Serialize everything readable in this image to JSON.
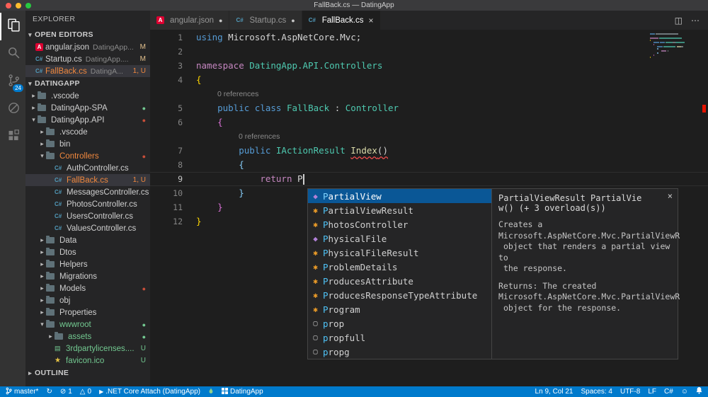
{
  "colors": {
    "accent": "#007acc",
    "error": "#f0883e",
    "untracked": "#73c991",
    "modified": "#e2c08d",
    "suggest_selected": "#0a5796",
    "status_bar": "#007acc",
    "error_marker": "#e51400"
  },
  "title_bar": {
    "title": "FallBack.cs — DatingApp"
  },
  "activity_bar": {
    "items": [
      {
        "name": "explorer",
        "active": true
      },
      {
        "name": "search"
      },
      {
        "name": "source-control",
        "badge": "24"
      },
      {
        "name": "debug"
      },
      {
        "name": "extensions"
      }
    ]
  },
  "sidebar": {
    "title": "EXPLORER",
    "sections": {
      "open_editors": {
        "label": "OPEN EDITORS",
        "items": [
          {
            "icon": "angular",
            "name": "angular.json",
            "detail": "DatingApp...",
            "badge": "M",
            "state": "modified"
          },
          {
            "icon": "csharp",
            "name": "Startup.cs",
            "detail": "DatingApp....",
            "badge": "M",
            "state": "modified"
          },
          {
            "icon": "csharp",
            "name": "FallBack.cs",
            "detail": "DatingA...",
            "badge": "1, U",
            "state": "error",
            "selected": true
          }
        ]
      },
      "project": {
        "label": "DATINGAPP",
        "tree": [
          {
            "name": ".vscode",
            "kind": "folder",
            "depth": 0,
            "arrow": "collapsed"
          },
          {
            "name": "DatingApp-SPA",
            "kind": "folder",
            "depth": 0,
            "arrow": "collapsed",
            "dot": "untracked"
          },
          {
            "name": "DatingApp.API",
            "kind": "folder",
            "depth": 0,
            "arrow": "expanded",
            "dot": "error"
          },
          {
            "name": ".vscode",
            "kind": "folder",
            "depth": 1,
            "arrow": "collapsed"
          },
          {
            "name": "bin",
            "kind": "folder",
            "depth": 1,
            "arrow": "collapsed"
          },
          {
            "name": "Controllers",
            "kind": "folder",
            "depth": 1,
            "arrow": "expanded",
            "state": "error",
            "dot": "error"
          },
          {
            "name": "AuthController.cs",
            "kind": "cs",
            "depth": 2
          },
          {
            "name": "FallBack.cs",
            "kind": "cs",
            "depth": 2,
            "state": "error",
            "badge": "1, U",
            "selected": true
          },
          {
            "name": "MessagesController.cs",
            "kind": "cs",
            "depth": 2
          },
          {
            "name": "PhotosController.cs",
            "kind": "cs",
            "depth": 2
          },
          {
            "name": "UsersController.cs",
            "kind": "cs",
            "depth": 2
          },
          {
            "name": "ValuesController.cs",
            "kind": "cs",
            "depth": 2
          },
          {
            "name": "Data",
            "kind": "folder",
            "depth": 1,
            "arrow": "collapsed"
          },
          {
            "name": "Dtos",
            "kind": "folder",
            "depth": 1,
            "arrow": "collapsed"
          },
          {
            "name": "Helpers",
            "kind": "folder",
            "depth": 1,
            "arrow": "collapsed"
          },
          {
            "name": "Migrations",
            "kind": "folder",
            "depth": 1,
            "arrow": "collapsed"
          },
          {
            "name": "Models",
            "kind": "folder",
            "depth": 1,
            "arrow": "collapsed",
            "dot": "error"
          },
          {
            "name": "obj",
            "kind": "folder",
            "depth": 1,
            "arrow": "collapsed"
          },
          {
            "name": "Properties",
            "kind": "folder",
            "depth": 1,
            "arrow": "collapsed"
          },
          {
            "name": "wwwroot",
            "kind": "folder",
            "depth": 1,
            "arrow": "expanded",
            "state": "untracked",
            "dot": "untracked"
          },
          {
            "name": "assets",
            "kind": "folder",
            "depth": 2,
            "arrow": "collapsed",
            "state": "untracked",
            "dot": "untracked"
          },
          {
            "name": "3rdpartylicenses....",
            "kind": "file",
            "depth": 2,
            "state": "untracked",
            "badge": "U"
          },
          {
            "name": "favicon.ico",
            "kind": "favicon",
            "depth": 2,
            "state": "untracked",
            "badge": "U"
          }
        ]
      },
      "outline": {
        "label": "OUTLINE"
      }
    }
  },
  "tabs": {
    "close_glyph": "×",
    "dirty_glyph": "●",
    "items": [
      {
        "icon": "angular",
        "label": "angular.json",
        "dirty": true
      },
      {
        "icon": "csharp",
        "label": "Startup.cs",
        "dirty": true
      },
      {
        "icon": "csharp",
        "label": "FallBack.cs",
        "active": true,
        "closable": true
      }
    ],
    "actions": [
      {
        "name": "split-editor",
        "glyph": "◫"
      },
      {
        "name": "more-actions",
        "glyph": "⋯"
      }
    ]
  },
  "editor": {
    "codelens_text": "0 references",
    "rows": [
      {
        "type": "code",
        "num": "1",
        "tokens": [
          [
            "using",
            "kb"
          ],
          [
            " ",
            "pl"
          ],
          [
            "Microsoft.AspNetCore.Mvc;",
            "pl"
          ]
        ]
      },
      {
        "type": "code",
        "num": "2",
        "tokens": []
      },
      {
        "type": "code",
        "num": "3",
        "tokens": [
          [
            "namespace",
            "kp"
          ],
          [
            " ",
            "pl"
          ],
          [
            "DatingApp.API.Controllers",
            "ty"
          ]
        ]
      },
      {
        "type": "code",
        "num": "4",
        "tokens": [
          [
            "{",
            "b1"
          ]
        ]
      },
      {
        "type": "lens",
        "indent": 4
      },
      {
        "type": "code",
        "num": "5",
        "tokens": [
          [
            "    ",
            "pl"
          ],
          [
            "public",
            "kb"
          ],
          [
            " ",
            "pl"
          ],
          [
            "class",
            "kb"
          ],
          [
            " ",
            "pl"
          ],
          [
            "FallBack",
            "ty"
          ],
          [
            " : ",
            "pl"
          ],
          [
            "Controller",
            "ty"
          ]
        ]
      },
      {
        "type": "code",
        "num": "6",
        "tokens": [
          [
            "    ",
            "pl"
          ],
          [
            "{",
            "b2"
          ]
        ]
      },
      {
        "type": "lens",
        "indent": 8
      },
      {
        "type": "code",
        "num": "7",
        "tokens": [
          [
            "        ",
            "pl"
          ],
          [
            "public",
            "kb"
          ],
          [
            " ",
            "pl"
          ],
          [
            "IActionResult",
            "ty"
          ],
          [
            " ",
            "pl"
          ],
          [
            "Index",
            "fn sq"
          ],
          [
            "()",
            "pl sq"
          ]
        ]
      },
      {
        "type": "code",
        "num": "8",
        "tokens": [
          [
            "        ",
            "pl"
          ],
          [
            "{",
            "b3"
          ]
        ]
      },
      {
        "type": "code",
        "num": "9",
        "current": true,
        "tokens": [
          [
            "            ",
            "pl"
          ],
          [
            "return",
            "kp"
          ],
          [
            " ",
            "pl"
          ],
          [
            "P",
            "pl"
          ],
          [
            "",
            "cur"
          ]
        ]
      },
      {
        "type": "code",
        "num": "10",
        "tokens": [
          [
            "        ",
            "pl"
          ],
          [
            "}",
            "b3"
          ]
        ]
      },
      {
        "type": "code",
        "num": "11",
        "tokens": [
          [
            "    ",
            "pl"
          ],
          [
            "}",
            "b2"
          ]
        ]
      },
      {
        "type": "code",
        "num": "12",
        "tokens": [
          [
            "}",
            "b1"
          ]
        ]
      }
    ]
  },
  "suggest": {
    "items": [
      {
        "label": "PartialView",
        "kind": "method",
        "selected": true
      },
      {
        "label": "PartialViewResult",
        "kind": "class"
      },
      {
        "label": "PhotosController",
        "kind": "class"
      },
      {
        "label": "PhysicalFile",
        "kind": "method"
      },
      {
        "label": "PhysicalFileResult",
        "kind": "class"
      },
      {
        "label": "ProblemDetails",
        "kind": "class"
      },
      {
        "label": "ProducesAttribute",
        "kind": "class"
      },
      {
        "label": "ProducesResponseTypeAttribute",
        "kind": "class"
      },
      {
        "label": "Program",
        "kind": "class"
      },
      {
        "label": "prop",
        "kind": "snippet"
      },
      {
        "label": "propfull",
        "kind": "snippet"
      },
      {
        "label": "propg",
        "kind": "snippet"
      }
    ],
    "doc": {
      "close": "×",
      "signature_lines": [
        "PartialViewResult PartialVie",
        "w() (+ 3 overload(s))"
      ],
      "description_lines": [
        "Creates a",
        "Microsoft.AspNetCore.Mvc.PartialViewR",
        " object that renders a partial view to",
        " the response."
      ],
      "returns_lines": [
        "Returns: The created",
        "Microsoft.AspNetCore.Mvc.PartialViewR",
        " object for the response."
      ]
    }
  },
  "status_bar": {
    "left": [
      {
        "icon": "branch",
        "label": "master*"
      },
      {
        "icon": "sync",
        "label": ""
      },
      {
        "icon": "error",
        "label": "1"
      },
      {
        "icon": "warning",
        "label": "0"
      },
      {
        "icon": "play",
        "label": ".NET Core Attach (DatingApp)"
      },
      {
        "icon": "flame",
        "label": ""
      },
      {
        "icon": "project",
        "label": "DatingApp"
      }
    ],
    "right": [
      {
        "label": "Ln 9, Col 21"
      },
      {
        "label": "Spaces: 4"
      },
      {
        "label": "UTF-8"
      },
      {
        "label": "LF"
      },
      {
        "label": "C#"
      },
      {
        "icon": "smiley",
        "label": ""
      },
      {
        "icon": "bell",
        "label": ""
      }
    ]
  }
}
